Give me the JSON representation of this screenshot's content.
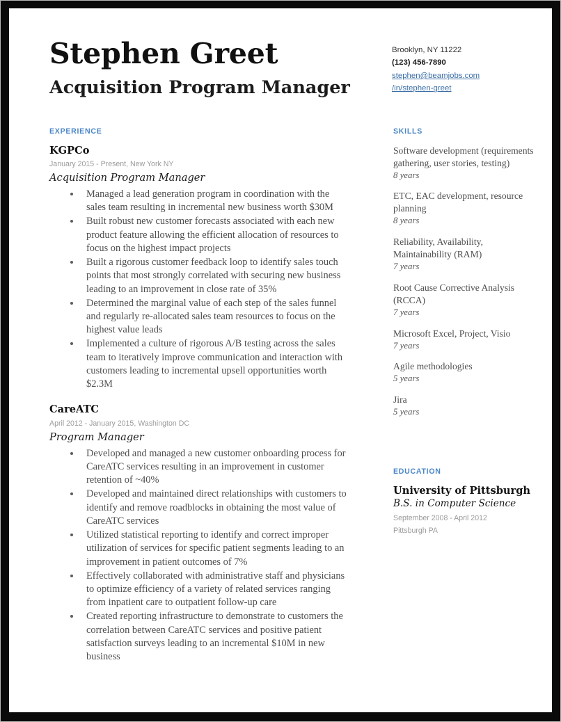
{
  "header": {
    "name": "Stephen Greet",
    "job_title": "Acquisition Program Manager",
    "contact": {
      "location": "Brooklyn, NY 11222",
      "phone": "(123) 456-7890",
      "email": "stephen@beamjobs.com",
      "linkedin": "/in/stephen-greet"
    }
  },
  "colors": {
    "accent_blue": "#4a86c8",
    "link_blue": "#3a6ea5",
    "body_text": "#4e4e4e",
    "meta_gray": "#9b9b9b",
    "frame_black": "#0a0a0a"
  },
  "experience": {
    "heading": "EXPERIENCE",
    "jobs": [
      {
        "company": "KGPCo",
        "meta": "January 2015 - Present, New York NY",
        "role": "Acquisition Program Manager",
        "bullets": [
          "Managed a lead generation program in coordination with the sales team resulting in incremental new business worth $30M",
          "Built robust new customer forecasts associated with each new product feature allowing the efficient allocation of resources to focus on the highest impact projects",
          "Built a rigorous customer feedback loop to identify sales touch points that most strongly correlated with securing new business leading to an improvement in close rate of 35%",
          "Determined the marginal value of each step of the sales funnel and regularly re-allocated sales team resources to focus on the highest value leads",
          "Implemented a culture of rigorous A/B testing across the sales team to iteratively improve communication and interaction with customers leading to incremental upsell opportunities worth $2.3M"
        ]
      },
      {
        "company": "CareATC",
        "meta": "April 2012 - January 2015, Washington DC",
        "role": "Program Manager",
        "bullets": [
          "Developed and managed a new customer onboarding process for CareATC services resulting in an improvement in customer retention of ~40%",
          "Developed and maintained direct relationships with customers to identify and remove roadblocks in obtaining the most value of CareATC services",
          "Utilized statistical reporting to identify and correct improper utilization of services for specific patient segments leading to an improvement in patient outcomes of 7%",
          "Effectively collaborated with administrative staff and physicians to optimize efficiency of a variety of related services ranging from inpatient care to outpatient follow-up care",
          "Created reporting infrastructure to demonstrate to customers the correlation between CareATC services and positive patient satisfaction surveys leading to an incremental $10M in new business"
        ]
      }
    ]
  },
  "skills": {
    "heading": "SKILLS",
    "items": [
      {
        "name": "Software development (requirements gathering, user stories, testing)",
        "years": "8 years"
      },
      {
        "name": "ETC, EAC development, resource planning",
        "years": "8 years"
      },
      {
        "name": "Reliability, Availability, Maintainability (RAM)",
        "years": "7 years"
      },
      {
        "name": "Root Cause Corrective Analysis (RCCA)",
        "years": "7 years"
      },
      {
        "name": "Microsoft Excel, Project, Visio",
        "years": "7 years"
      },
      {
        "name": "Agile methodologies",
        "years": "5 years"
      },
      {
        "name": "Jira",
        "years": "5 years"
      }
    ]
  },
  "education": {
    "heading": "EDUCATION",
    "school": "University of Pittsburgh",
    "degree": "B.S. in Computer Science",
    "dates": "September 2008 - April 2012",
    "location": "Pittsburgh PA"
  }
}
